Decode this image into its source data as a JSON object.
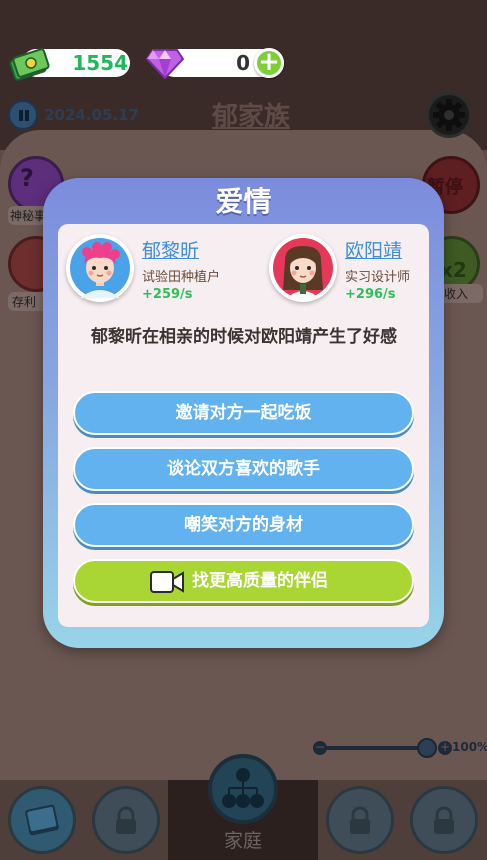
{
  "hud": {
    "money": "1554",
    "gems": "0",
    "date": "2024.05.17",
    "family_name": "郁家族"
  },
  "side_buttons": {
    "mystery_label": "神秘事",
    "savings_label": "存利",
    "pause_label": "暂停",
    "double_label": "倍收入",
    "double_icon_text": "x2"
  },
  "zoom": {
    "label": "100%"
  },
  "bottom_tabs": {
    "family_label": "家庭"
  },
  "dialog": {
    "title": "爱情",
    "left_person": {
      "name": "郁黎昕",
      "job": "试验田种植户",
      "rate": "+259/s"
    },
    "right_person": {
      "name": "欧阳靖",
      "job": "实习设计师",
      "rate": "+296/s"
    },
    "event_text": "郁黎昕在相亲的时候对欧阳靖产生了好感",
    "choices": [
      "邀请对方一起吃饭",
      "谈论双方喜欢的歌手",
      "嘲笑对方的身材"
    ],
    "video_choice": "找更高质量的伴侣"
  },
  "colors": {
    "money_green": "#1fb95b",
    "choice_blue": "#61b2ef",
    "video_green": "#a9d632",
    "name_blue": "#3c8fd8",
    "rate_green": "#2fbf57"
  }
}
